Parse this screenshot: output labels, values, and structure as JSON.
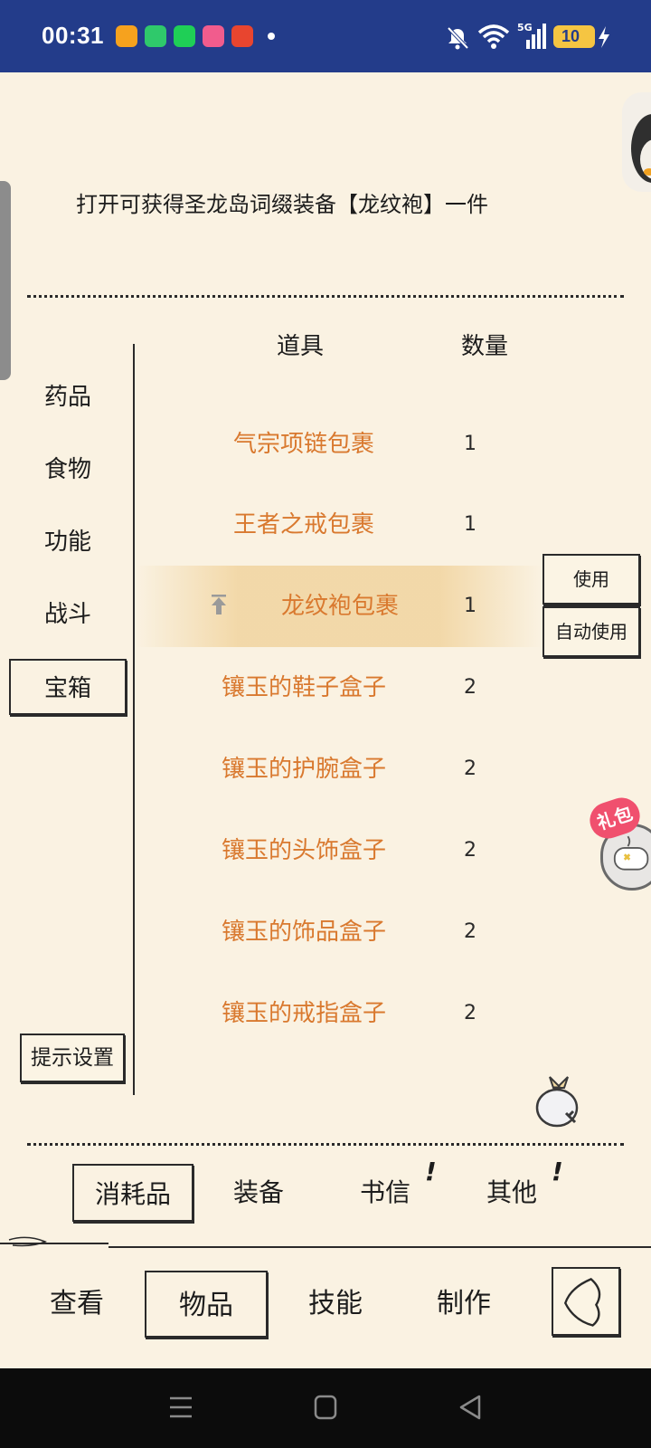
{
  "status_bar": {
    "time": "00:31",
    "signal_label": "5G",
    "battery": "10",
    "app_icons": [
      "#f6a21e",
      "#2fc96b",
      "#1fcf56",
      "#f15c8d",
      "#e8452f"
    ]
  },
  "description": "打开可获得圣龙岛词缀装备【龙纹袍】一件",
  "columns": {
    "item": "道具",
    "qty": "数量"
  },
  "categories": [
    {
      "label": "药品"
    },
    {
      "label": "食物"
    },
    {
      "label": "功能"
    },
    {
      "label": "战斗"
    },
    {
      "label": "宝箱",
      "active": true
    }
  ],
  "hint_settings": "提示设置",
  "items": [
    {
      "name": "气宗项链包裹",
      "qty": "1"
    },
    {
      "name": "王者之戒包裹",
      "qty": "1"
    },
    {
      "name": "龙纹袍包裹",
      "qty": "1",
      "selected": true
    },
    {
      "name": "镶玉的鞋子盒子",
      "qty": "2"
    },
    {
      "name": "镶玉的护腕盒子",
      "qty": "2"
    },
    {
      "name": "镶玉的头饰盒子",
      "qty": "2"
    },
    {
      "name": "镶玉的饰品盒子",
      "qty": "2"
    },
    {
      "name": "镶玉的戒指盒子",
      "qty": "2"
    }
  ],
  "actions": {
    "use": "使用",
    "auto_use": "自动使用"
  },
  "gift_badge": "礼包",
  "inventory_tabs": [
    {
      "label": "消耗品",
      "active": true
    },
    {
      "label": "装备"
    },
    {
      "label": "书信",
      "alert": "!"
    },
    {
      "label": "其他",
      "alert": "!"
    }
  ],
  "nav": [
    {
      "label": "查看"
    },
    {
      "label": "物品",
      "active": true
    },
    {
      "label": "技能"
    },
    {
      "label": "制作"
    }
  ],
  "colors": {
    "status_bar": "#233c8a",
    "background": "#faf2e2",
    "item_text": "#d9792f",
    "battery": "#f5c542",
    "gift_badge": "#f0506e"
  }
}
